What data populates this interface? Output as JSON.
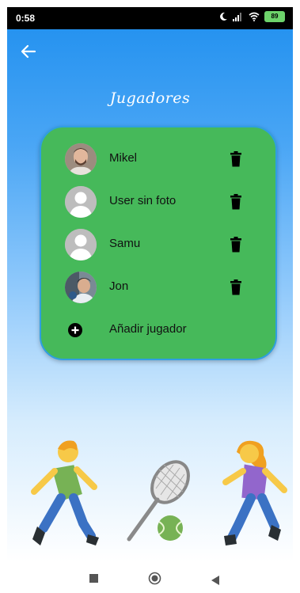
{
  "status_bar": {
    "time": "0:58",
    "battery": "89"
  },
  "header": {
    "back_icon": "arrow-left-icon",
    "title": "Jugadores"
  },
  "players": [
    {
      "name": "Mikel",
      "avatar": "photo"
    },
    {
      "name": "User sin foto",
      "avatar": "default"
    },
    {
      "name": "Samu",
      "avatar": "default"
    },
    {
      "name": "Jon",
      "avatar": "photo"
    }
  ],
  "add_player": {
    "label": "Añadir jugador",
    "icon": "plus-circle-icon"
  },
  "colors": {
    "card": "#46b95a",
    "card_border": "#2f9fe0",
    "gradient_top": "#1f8fef",
    "gradient_bottom": "#ffffff"
  },
  "illustration": [
    "runner-boy-icon",
    "tennis-racket-icon",
    "tennis-ball-icon",
    "runner-girl-icon"
  ],
  "nav_bar": [
    "square-icon",
    "circle-home-icon",
    "triangle-back-icon"
  ]
}
